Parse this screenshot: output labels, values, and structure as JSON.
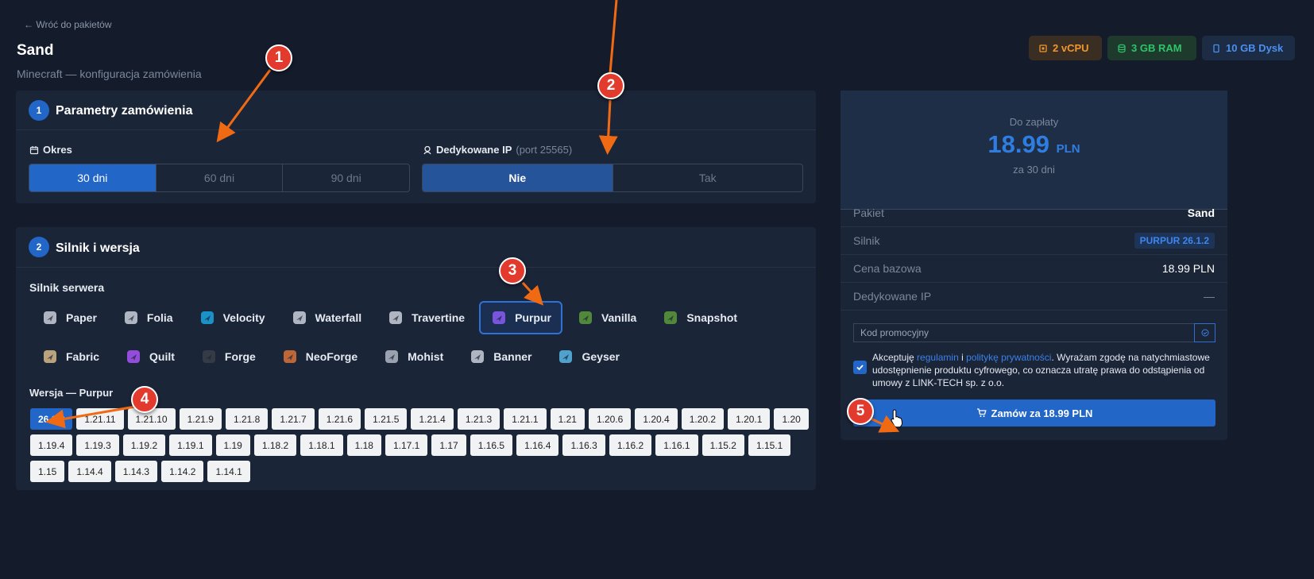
{
  "nav": {
    "back": "← Wróć do pakietów"
  },
  "header": {
    "title": "Sand",
    "subtitle": "Minecraft — konfiguracja zamówienia"
  },
  "resources": [
    {
      "label": "2 vCPU",
      "icon": "cpu-icon",
      "color": "#f0962f"
    },
    {
      "label": "3 GB RAM",
      "icon": "database-icon",
      "color": "#2ec46a"
    },
    {
      "label": "10 GB Dysk",
      "icon": "disk-icon",
      "color": "#4a8ff0"
    }
  ],
  "params": {
    "step": "1",
    "title": "Parametry zamówienia",
    "period_label": "Okres",
    "periods": [
      "30 dni",
      "60 dni",
      "90 dni"
    ],
    "selected_period": "30 dni",
    "ip_label": "Dedykowane IP",
    "ip_hint": "(port 25565)",
    "ip_options": [
      "Nie",
      "Tak"
    ],
    "selected_ip": "Nie"
  },
  "engine": {
    "step": "2",
    "title": "Silnik i wersja",
    "engine_label": "Silnik serwera",
    "engines_row1": [
      "Paper",
      "Folia",
      "Velocity",
      "Waterfall",
      "Travertine",
      "Purpur",
      "Vanilla",
      "Snapshot"
    ],
    "engines_row2": [
      "Fabric",
      "Quilt",
      "Forge",
      "NeoForge",
      "Mohist",
      "Banner",
      "Geyser"
    ],
    "selected_engine": "Purpur",
    "version_label": "Wersja — Purpur",
    "versions": [
      "26.1.2",
      "1.21.11",
      "1.21.10",
      "1.21.9",
      "1.21.8",
      "1.21.7",
      "1.21.6",
      "1.21.5",
      "1.21.4",
      "1.21.3",
      "1.21.1",
      "1.21",
      "1.20.6",
      "1.20.4",
      "1.20.2",
      "1.20.1",
      "1.20",
      "1.19.4",
      "1.19.3",
      "1.19.2",
      "1.19.1",
      "1.19",
      "1.18.2",
      "1.18.1",
      "1.18",
      "1.17.1",
      "1.17",
      "1.16.5",
      "1.16.4",
      "1.16.3",
      "1.16.2",
      "1.16.1",
      "1.15.2",
      "1.15.1",
      "1.15",
      "1.14.4",
      "1.14.3",
      "1.14.2",
      "1.14.1"
    ],
    "selected_version": "26.1.2"
  },
  "summary": {
    "due_label": "Do zapłaty",
    "amount": "18.99",
    "currency": "PLN",
    "period_note": "za 30 dni",
    "rows": [
      {
        "k": "Pakiet",
        "v": "Sand"
      },
      {
        "k": "Silnik",
        "v": "PURPUR 26.1.2"
      },
      {
        "k": "Cena bazowa",
        "v": "18.99 PLN"
      },
      {
        "k": "Dedykowane IP",
        "v": "—"
      }
    ],
    "promo_placeholder": "Kod promocyjny",
    "consent_pre": "Akceptuję ",
    "consent_link1": "regulamin",
    "consent_mid": " i ",
    "consent_link2": "politykę prywatności",
    "consent_post": ". Wyrażam zgodę na natychmiastowe udostępnienie produktu cyfrowego, co oznacza utratę prawa do odstąpienia od umowy z LINK-TECH sp. z o.o.",
    "order_label": "Zamów za 18.99 PLN"
  },
  "callouts": [
    "1",
    "2",
    "3",
    "4",
    "5"
  ]
}
